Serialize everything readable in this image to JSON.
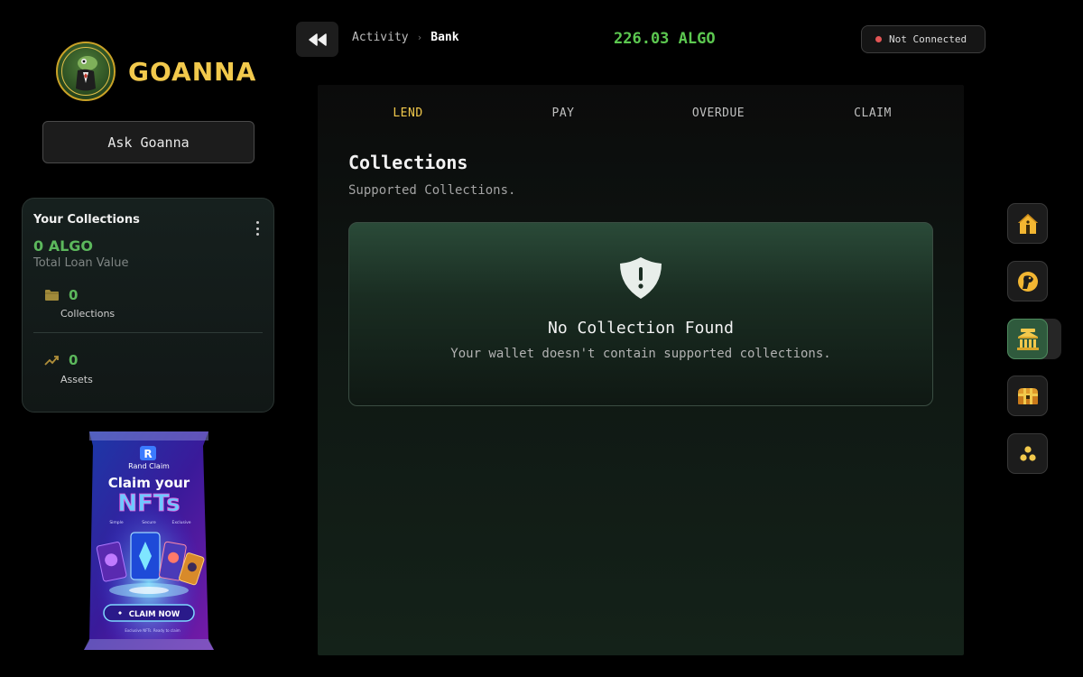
{
  "brand": {
    "name": "GOANNA",
    "logo_icon": "goanna-mascot-icon",
    "accent": "#f2c94c"
  },
  "sidebar": {
    "ask_button": "Ask Goanna",
    "collections_card": {
      "title": "Your Collections",
      "total_value": "0 ALGO",
      "total_label": "Total Loan Value",
      "stats": [
        {
          "icon": "folder-icon",
          "value": "0",
          "label": "Collections"
        },
        {
          "icon": "trending-up-icon",
          "value": "0",
          "label": "Assets"
        }
      ]
    },
    "promo": {
      "badge": "R",
      "brand": "Rand Claim",
      "headline_1": "Claim your",
      "headline_2": "NFTs",
      "features": [
        "Simple",
        "Secure",
        "Exclusive"
      ],
      "cta": "CLAIM NOW",
      "footnote": "Exclusive NFTs. Ready to claim"
    }
  },
  "header": {
    "back_icon": "rewind-icon",
    "breadcrumb": [
      "Activity",
      "Bank"
    ],
    "breadcrumb_separator": "›",
    "balance": "226.03 ALGO",
    "connection_status": "Not Connected",
    "status_color": "#e25555"
  },
  "main": {
    "tabs": [
      {
        "label": "LEND",
        "active": true
      },
      {
        "label": "PAY",
        "active": false
      },
      {
        "label": "OVERDUE",
        "active": false
      },
      {
        "label": "CLAIM",
        "active": false
      }
    ],
    "title": "Collections",
    "subtitle": "Supported Collections.",
    "empty_state": {
      "icon": "shield-alert-icon",
      "title": "No Collection Found",
      "message": "Your wallet doesn't contain supported collections."
    }
  },
  "rail": {
    "items": [
      {
        "icon": "home-icon",
        "active": false
      },
      {
        "icon": "goanna-head-icon",
        "active": false
      },
      {
        "icon": "bank-icon",
        "active": true
      },
      {
        "icon": "treasure-chest-icon",
        "active": false
      },
      {
        "icon": "coins-icon",
        "active": false
      }
    ]
  }
}
